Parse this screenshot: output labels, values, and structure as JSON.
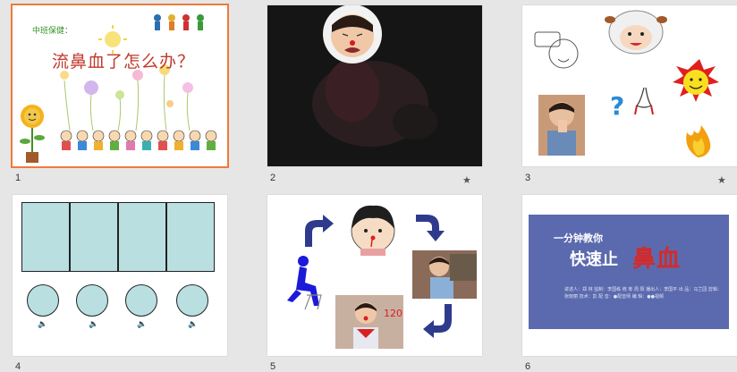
{
  "slides": [
    {
      "number": "1",
      "label": "中班保健：",
      "title": "流鼻血了怎么办？"
    },
    {
      "number": "2"
    },
    {
      "number": "3",
      "question_mark": "?"
    },
    {
      "number": "4"
    },
    {
      "number": "5",
      "phone": "120"
    },
    {
      "number": "6",
      "line1": "一分钟教你",
      "line2": "快速止",
      "line3": "鼻血",
      "credits": "讲述人：郑 林  监制：李国栋  统 筹  周 阳  播出人：李国平  出 品：马兰园  剪辑：张晓丽  技术：彭  配 音：●配音师 编 辑：●●视频"
    }
  ],
  "colors": {
    "background": "#e6e6e6",
    "selection_outline": "#ee7a3c",
    "title_red": "#c0392b",
    "box_fill": "#b9dfe1",
    "banner": "#5b6aae"
  },
  "icons": {
    "animation_marker": "star-icon",
    "audio_marker": "speaker-icon"
  }
}
